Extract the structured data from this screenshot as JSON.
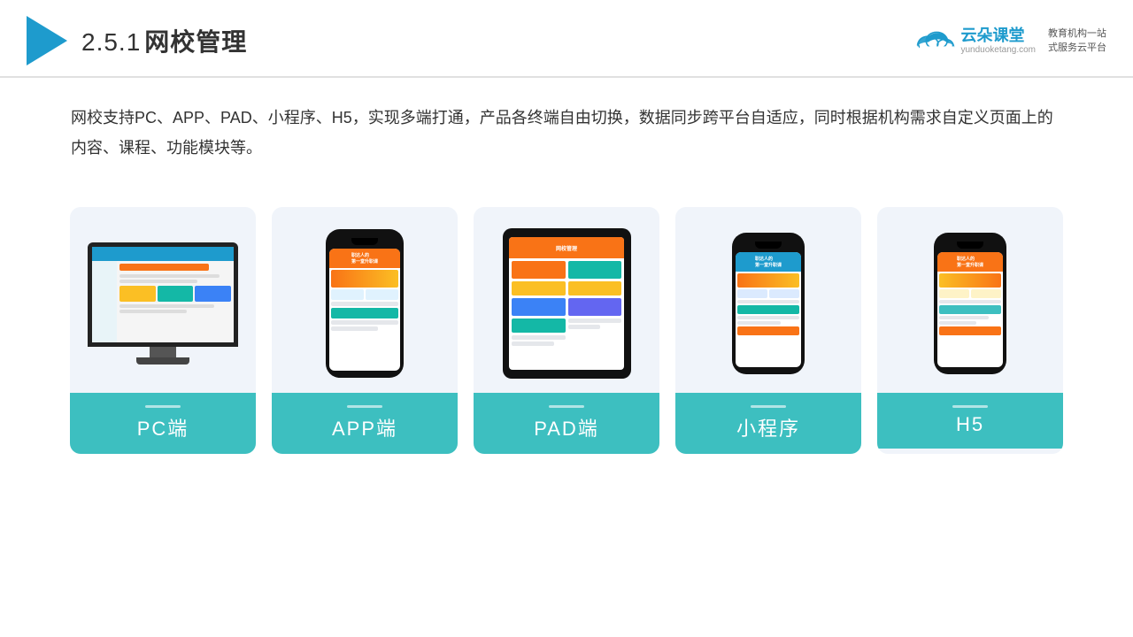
{
  "header": {
    "title": "2.5.1网校管理",
    "title_num": "2.5.1",
    "title_text": "网校管理",
    "brand": {
      "name": "云朵课堂",
      "url": "yunduoketang.com",
      "slogan": "教育机构一站\n式服务云平台"
    }
  },
  "description": "网校支持PC、APP、PAD、小程序、H5，实现多端打通，产品各终端自由切换，数据同步跨平台自适应，同时根据机构需求自定义页面上的内容、课程、功能模块等。",
  "cards": [
    {
      "id": "pc",
      "label": "PC端"
    },
    {
      "id": "app",
      "label": "APP端"
    },
    {
      "id": "pad",
      "label": "PAD端"
    },
    {
      "id": "miniapp",
      "label": "小程序"
    },
    {
      "id": "h5",
      "label": "H5"
    }
  ]
}
